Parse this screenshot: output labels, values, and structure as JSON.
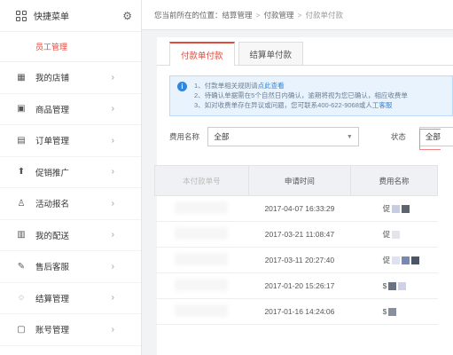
{
  "sidebar": {
    "title": "快捷菜单",
    "sub_item": "员工管理",
    "items": [
      {
        "label": "我的店铺",
        "icon": "store-icon"
      },
      {
        "label": "商品管理",
        "icon": "product-icon"
      },
      {
        "label": "订单管理",
        "icon": "order-icon"
      },
      {
        "label": "促销推广",
        "icon": "promotion-icon"
      },
      {
        "label": "活动报名",
        "icon": "activity-icon"
      },
      {
        "label": "我的配送",
        "icon": "delivery-icon"
      },
      {
        "label": "售后客服",
        "icon": "service-icon"
      },
      {
        "label": "结算管理",
        "icon": "settlement-icon"
      },
      {
        "label": "账号管理",
        "icon": "account-icon"
      }
    ]
  },
  "breadcrumb": {
    "prefix": "您当前所在的位置：",
    "level1": "结算管理",
    "level2": "付款管理",
    "current": "付款单付款",
    "sep": ">"
  },
  "tabs": [
    {
      "label": "付款单付款",
      "active": true
    },
    {
      "label": "结算单付款",
      "active": false
    }
  ],
  "notice": {
    "line1_text": "1、付款单相关规则请",
    "line1_link": "点此查看",
    "line2_text": "2、待确认单据需在5个自然日内确认，逾期将视为您已确认，相应收费单",
    "line3_text": "3、如对收费单存在异议或问题，您可联系400-622-9068或人",
    "line3_link": "工客服"
  },
  "filters": {
    "fee_label": "费用名称",
    "fee_value": "全部",
    "status_label": "状态",
    "status_value": "全部"
  },
  "table": {
    "headers": [
      "本付款单号",
      "申请时间",
      "费用名称"
    ],
    "rows": [
      {
        "time": "2017-04-07 16:33:29",
        "fee": "促"
      },
      {
        "time": "2017-03-21 11:08:47",
        "fee": "促"
      },
      {
        "time": "2017-03-11 20:27:40",
        "fee": "促"
      },
      {
        "time": "2017-01-20 15:26:17",
        "fee": "$"
      },
      {
        "time": "2017-01-16 14:24:06",
        "fee": "$"
      }
    ]
  },
  "colors": {
    "accent": "#e24a3b",
    "info": "#2e86de"
  }
}
